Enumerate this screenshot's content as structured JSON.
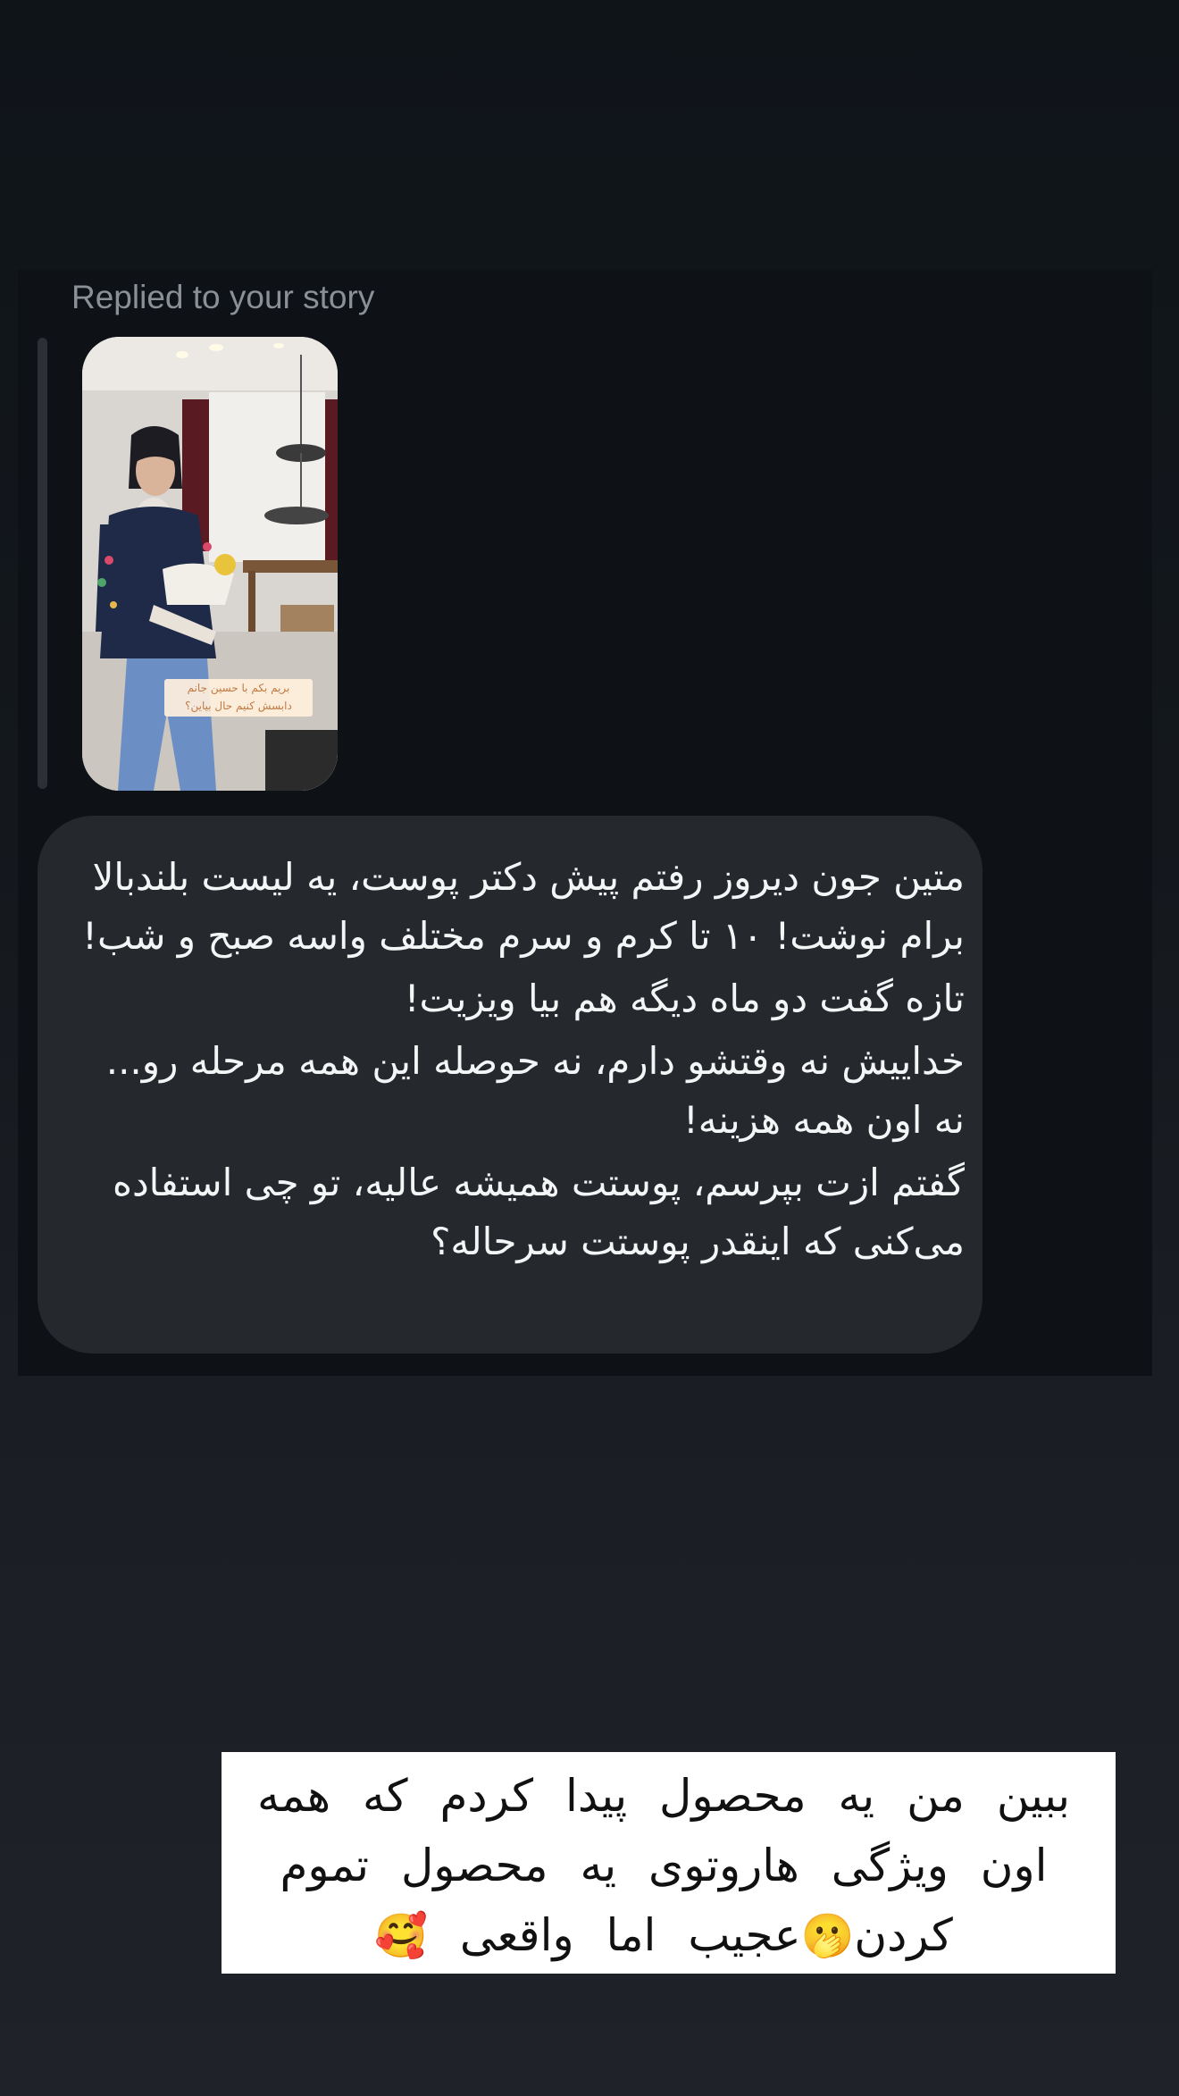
{
  "reply": {
    "label": "Replied to your story"
  },
  "story": {
    "caption_line1": "بریم بکم با حسین جانم",
    "caption_line2": "دابسش کنیم حال بیاین؟"
  },
  "message": {
    "paragraphs": [
      "متین جون دیروز رفتم پیش دکتر پوست، یه لیست بلندبالا برام نوشت! ۱۰ تا کرم و سرم مختلف واسه صبح و شب!",
      "تازه گفت دو ماه دیگه هم بیا ویزیت!",
      "خداییش نه وقتشو دارم، نه حوصله این همه مرحله رو... نه اون همه هزینه!",
      "گفتم ازت بپرسم، پوستت همیشه عالیه، تو چی استفاده می‌کنی که اینقدر پوستت سرحاله؟"
    ]
  },
  "sticker": {
    "line1": "ببین من یه محصول پیدا کردم که همه",
    "line2": "اون ویژگی هاروتوی یه محصول تموم",
    "line3_before_emoji": "کردن",
    "line3_emoji1": "🫢",
    "line3_after_emoji": "عجیب اما واقعی",
    "line3_emoji2": "🥰"
  },
  "colors": {
    "background": "#14181d",
    "bubble": "#25282d",
    "label": "#8b9097",
    "sticker_bg": "#ffffff"
  }
}
